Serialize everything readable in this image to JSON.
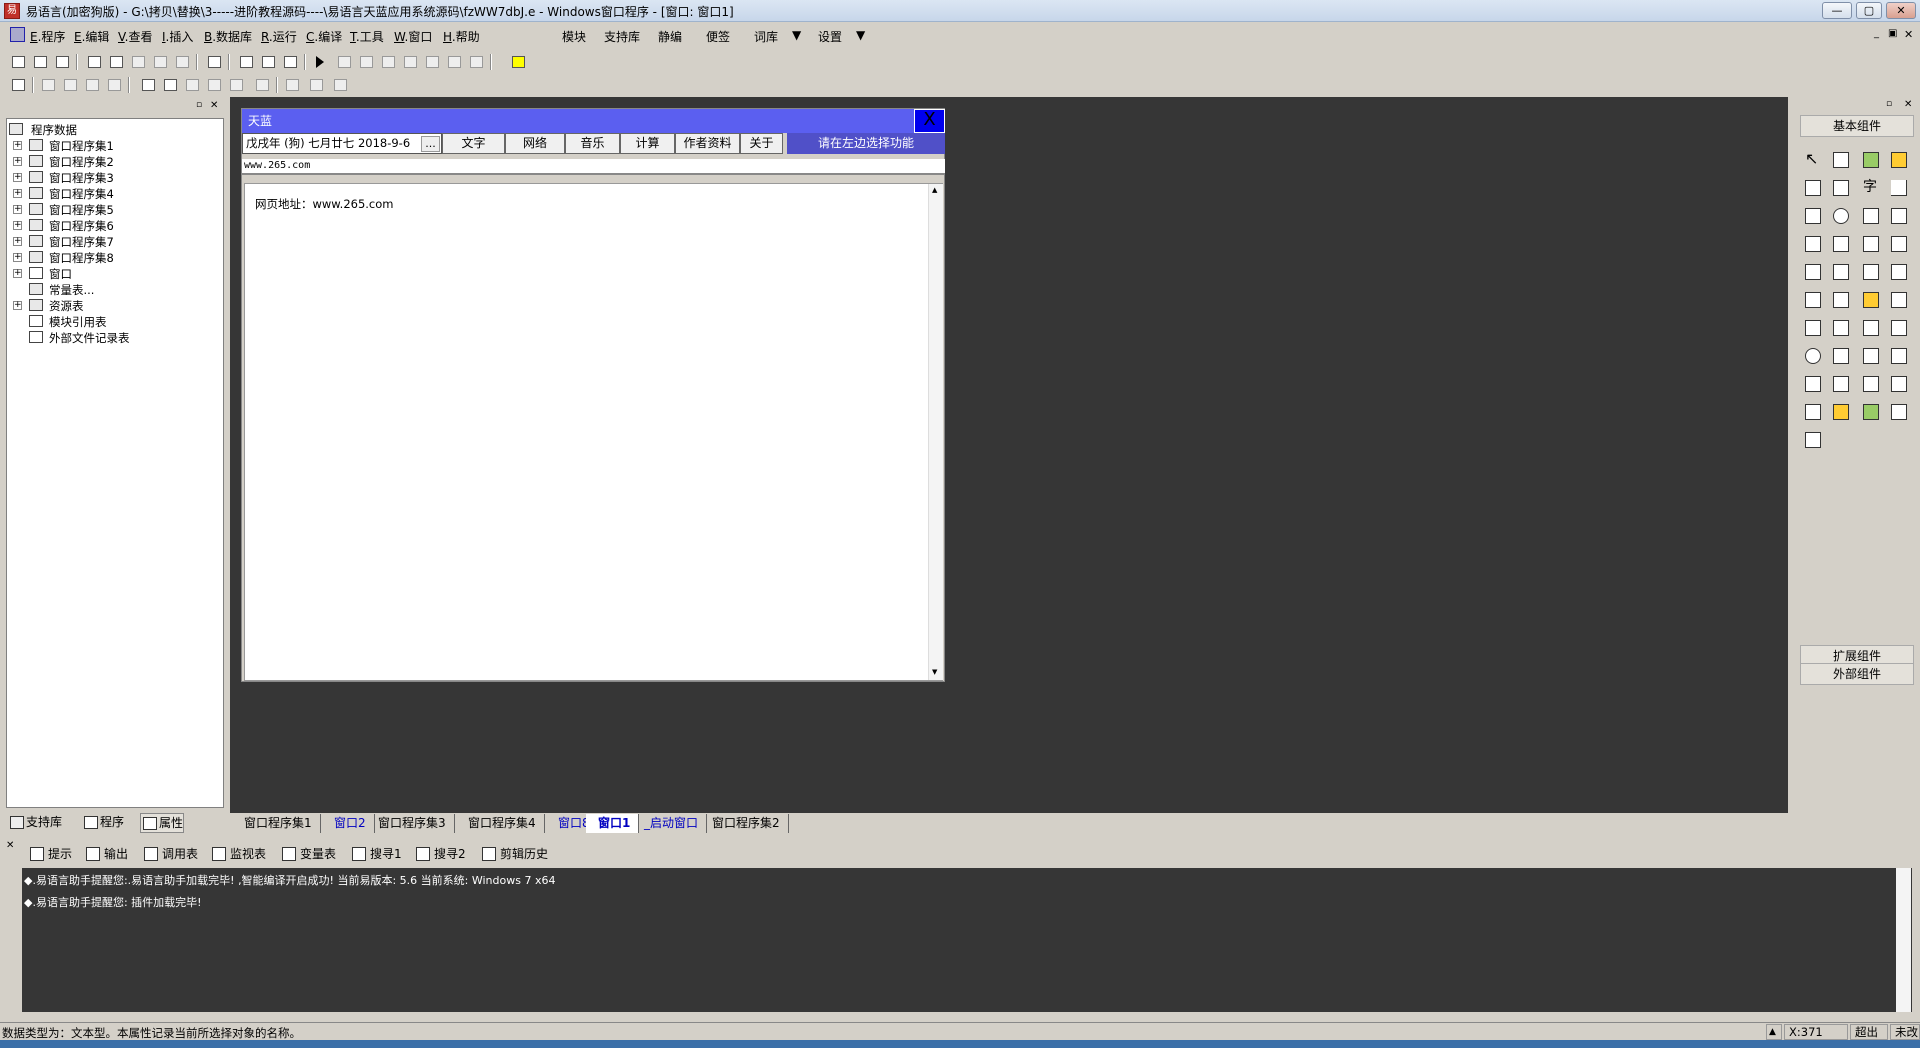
{
  "titlebar": {
    "title": "易语言(加密狗版) - G:\\拷贝\\替换\\3-----进阶教程源码----\\易语言天蓝应用系统源码\\fzWW7dbJ.e - Windows窗口程序 - [窗口: 窗口1]",
    "min": "—",
    "max": "▢",
    "close": "✕"
  },
  "menubar": {
    "items": [
      {
        "key": "E",
        "label": ".程序"
      },
      {
        "key": "E",
        "label": ".编辑"
      },
      {
        "key": "V",
        "label": ".查看"
      },
      {
        "key": "I",
        "label": ".插入"
      },
      {
        "key": "B",
        "label": ".数据库"
      },
      {
        "key": "R",
        "label": ".运行"
      },
      {
        "key": "C",
        "label": ".编译"
      },
      {
        "key": "T",
        "label": ".工具"
      },
      {
        "key": "W",
        "label": ".窗口"
      },
      {
        "key": "H",
        "label": ".帮助"
      }
    ],
    "extra": [
      "模块",
      "支持库",
      "静编",
      "便签",
      "词库",
      "设置"
    ]
  },
  "tree": {
    "root": "程序数据",
    "items": [
      "窗口程序集1",
      "窗口程序集2",
      "窗口程序集3",
      "窗口程序集4",
      "窗口程序集5",
      "窗口程序集6",
      "窗口程序集7",
      "窗口程序集8",
      "窗口",
      "常量表...",
      "资源表",
      "模块引用表",
      "外部文件记录表"
    ]
  },
  "left_tabs": [
    "支持库",
    "程序",
    "属性"
  ],
  "form": {
    "title": "天蓝",
    "close": "X",
    "date": "戊戌年 (狗) 七月廿七  2018-9-6",
    "date_btn": "...",
    "buttons": [
      "文字",
      "网络",
      "音乐",
      "计算",
      "作者资料",
      "关于"
    ],
    "func_label": "请在左边选择功能",
    "url": "www.265.com",
    "web_text": "网页地址：www.265.com"
  },
  "doc_tabs": [
    "窗口程序集1",
    "窗口2",
    "窗口程序集3",
    "窗口程序集4",
    "窗口8",
    "窗口1",
    "_启动窗口",
    "窗口程序集2"
  ],
  "right_panel": {
    "header": "基本组件",
    "ext": "扩展组件",
    "ext2": "外部组件"
  },
  "output_tabs": [
    "提示",
    "输出",
    "调用表",
    "监视表",
    "变量表",
    "搜寻1",
    "搜寻2",
    "剪辑历史"
  ],
  "output_lines": [
    "◆.易语言助手提醒您:.易语言助手加载完毕!  ,智能编译开启成功!  当前易版本: 5.6  当前系统: Windows 7 x64",
    "◆.易语言助手提醒您: 插件加载完毕!"
  ],
  "status": {
    "message": "数据类型为：文本型。本属性记录当前所选择对象的名称。",
    "x": "X:371",
    "mode": "超出",
    "state": "未改"
  }
}
